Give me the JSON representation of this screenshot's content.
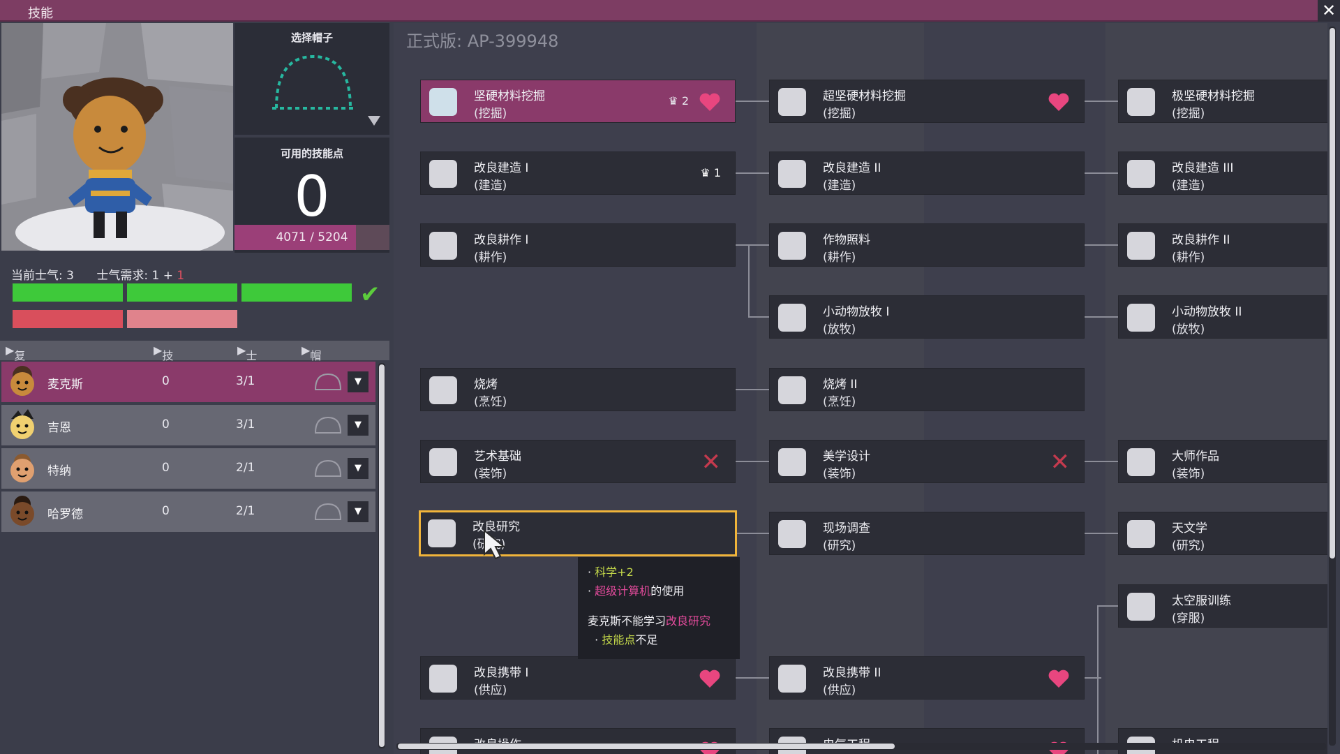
{
  "window": {
    "title": "技能"
  },
  "hat_panel": {
    "label": "选择帽子"
  },
  "points_panel": {
    "label": "可用的技能点",
    "value": "0",
    "xp": "4071 / 5204",
    "xp_fraction": 0.782
  },
  "morale": {
    "current_label": "当前士气: 3",
    "req_label": "士气需求: 1 + ",
    "req_extra": "1"
  },
  "list_header": {
    "col1": "复制人",
    "col2": "技能点",
    "col3": "士气",
    "col4": "帽子"
  },
  "dupes": [
    {
      "name": "麦克斯",
      "points": "0",
      "morale": "3/1",
      "selected": true
    },
    {
      "name": "吉恩",
      "points": "0",
      "morale": "3/1",
      "selected": false
    },
    {
      "name": "特纳",
      "points": "0",
      "morale": "2/1",
      "selected": false
    },
    {
      "name": "哈罗德",
      "points": "0",
      "morale": "2/1",
      "selected": false
    }
  ],
  "version": "正式版: AP-399948",
  "skills": {
    "r1c1": {
      "name": "坚硬材料挖掘",
      "group": "(挖掘)",
      "count": "2"
    },
    "r1c2": {
      "name": "超坚硬材料挖掘",
      "group": "(挖掘)"
    },
    "r1c3": {
      "name": "极坚硬材料挖掘",
      "group": "(挖掘)"
    },
    "r2c1": {
      "name": "改良建造 I",
      "group": "(建造)",
      "count": "1"
    },
    "r2c2": {
      "name": "改良建造 II",
      "group": "(建造)"
    },
    "r2c3": {
      "name": "改良建造 III",
      "group": "(建造)"
    },
    "r3c1": {
      "name": "改良耕作 I",
      "group": "(耕作)"
    },
    "r3c2": {
      "name": "作物照料",
      "group": "(耕作)"
    },
    "r3c3": {
      "name": "改良耕作 II",
      "group": "(耕作)"
    },
    "r4c2": {
      "name": "小动物放牧 I",
      "group": "(放牧)"
    },
    "r4c3": {
      "name": "小动物放牧 II",
      "group": "(放牧)"
    },
    "r5c1": {
      "name": "烧烤",
      "group": "(烹饪)"
    },
    "r5c2": {
      "name": "烧烤 II",
      "group": "(烹饪)"
    },
    "r6c1": {
      "name": "艺术基础",
      "group": "(装饰)"
    },
    "r6c2": {
      "name": "美学设计",
      "group": "(装饰)"
    },
    "r6c3": {
      "name": "大师作品",
      "group": "(装饰)"
    },
    "r7c1": {
      "name": "改良研究",
      "group": "(研究)"
    },
    "r7c2": {
      "name": "现场调查",
      "group": "(研究)"
    },
    "r7c3": {
      "name": "天文学",
      "group": "(研究)"
    },
    "r8c3": {
      "name": "太空服训练",
      "group": "(穿服)"
    },
    "r9c1": {
      "name": "改良携带 I",
      "group": "(供应)"
    },
    "r9c2": {
      "name": "改良携带 II",
      "group": "(供应)"
    },
    "r10c1": {
      "name": "改良操作",
      "group": ""
    },
    "r10c2": {
      "name": "电气工程",
      "group": ""
    },
    "r10c3": {
      "name": "机电工程",
      "group": ""
    }
  },
  "tooltip": {
    "line1": "科学+2",
    "line2_hl": "超级计算机",
    "line2_rest": "的使用",
    "line3_pre": "麦克斯不能学习",
    "line3_hl": "改良研究",
    "line4": "技能点",
    "line4_rest": "不足"
  },
  "icons": {
    "close": "close-icon",
    "dropdown": "chevron-down-icon",
    "heart": "heart-icon",
    "check": "check-icon",
    "x": "x-icon",
    "crown": "crown-icon"
  },
  "colors": {
    "accent": "#8a3a6a",
    "morale_green": "#3ec93a",
    "morale_red": "#d94f5c",
    "heart": "#e8467f",
    "highlight": "#f0b43a"
  }
}
